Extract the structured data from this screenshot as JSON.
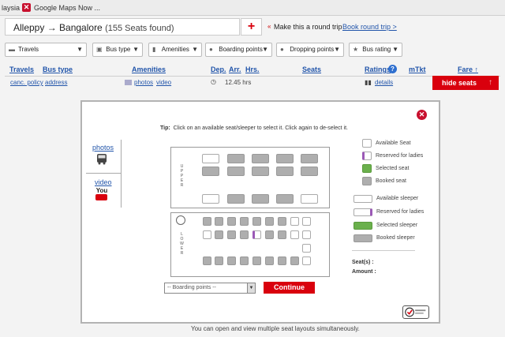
{
  "bookmarks": {
    "item1": "laysia",
    "item2": "Google Maps Now ..."
  },
  "header": {
    "route": "Alleppy → Bangalore",
    "seats_found": "(155 Seats found)",
    "add": "+",
    "round_trip_text": "Make this a round trip",
    "round_trip_link": "Book round trip >"
  },
  "filters": [
    {
      "label": "Travels",
      "icon": "bus-icon"
    },
    {
      "label": "Bus type",
      "icon": "bus-icon"
    },
    {
      "label": "Amenities",
      "icon": "bottle-icon"
    },
    {
      "label": "Boarding points",
      "icon": "map-pin-icon"
    },
    {
      "label": "Dropping points",
      "icon": "map-pin-icon"
    },
    {
      "label": "Bus rating",
      "icon": "star-icon"
    }
  ],
  "table": {
    "headers": [
      "Travels",
      "Bus type",
      "Amenities",
      "Dep.",
      "Arr.",
      "Hrs.",
      "Seats",
      "Ratings",
      "mTkt",
      "Fare ↑"
    ],
    "row": {
      "canc_policy": "canc. policy",
      "address": "address",
      "photos": "photos",
      "video": "video",
      "duration": "12.45 hrs",
      "details": "details",
      "hide_seats": "hide seats"
    }
  },
  "modal": {
    "tip_label": "Tip:",
    "tip_text": "Click on an available seat/sleeper to select it. Click again to de-select it.",
    "photos_link": "photos",
    "video_link": "video",
    "youtube": "You",
    "upper_label": "UPPER",
    "lower_label": "LOWER",
    "legend": {
      "available_seat": "Available Seat",
      "reserved_ladies": "Reserved for ladies",
      "selected_seat": "Selected seat",
      "booked_seat": "Booked seat",
      "available_sleeper": "Available sleeper",
      "reserved_ladies_sleeper": "Reserved for ladies",
      "selected_sleeper": "Selected sleeper",
      "booked_sleeper": "Booked sleeper"
    },
    "seats_label": "Seat(s) :",
    "amount_label": "Amount :",
    "boarding_placeholder": "-- Boarding points --",
    "continue": "Continue",
    "footer": "You can open and view multiple seat layouts simultaneously."
  },
  "colors": {
    "accent_red": "#d9000d",
    "link_blue": "#2255aa",
    "selected_green": "#6ab04c",
    "ladies_purple": "#9b59b6",
    "booked_grey": "#aeaeae"
  }
}
